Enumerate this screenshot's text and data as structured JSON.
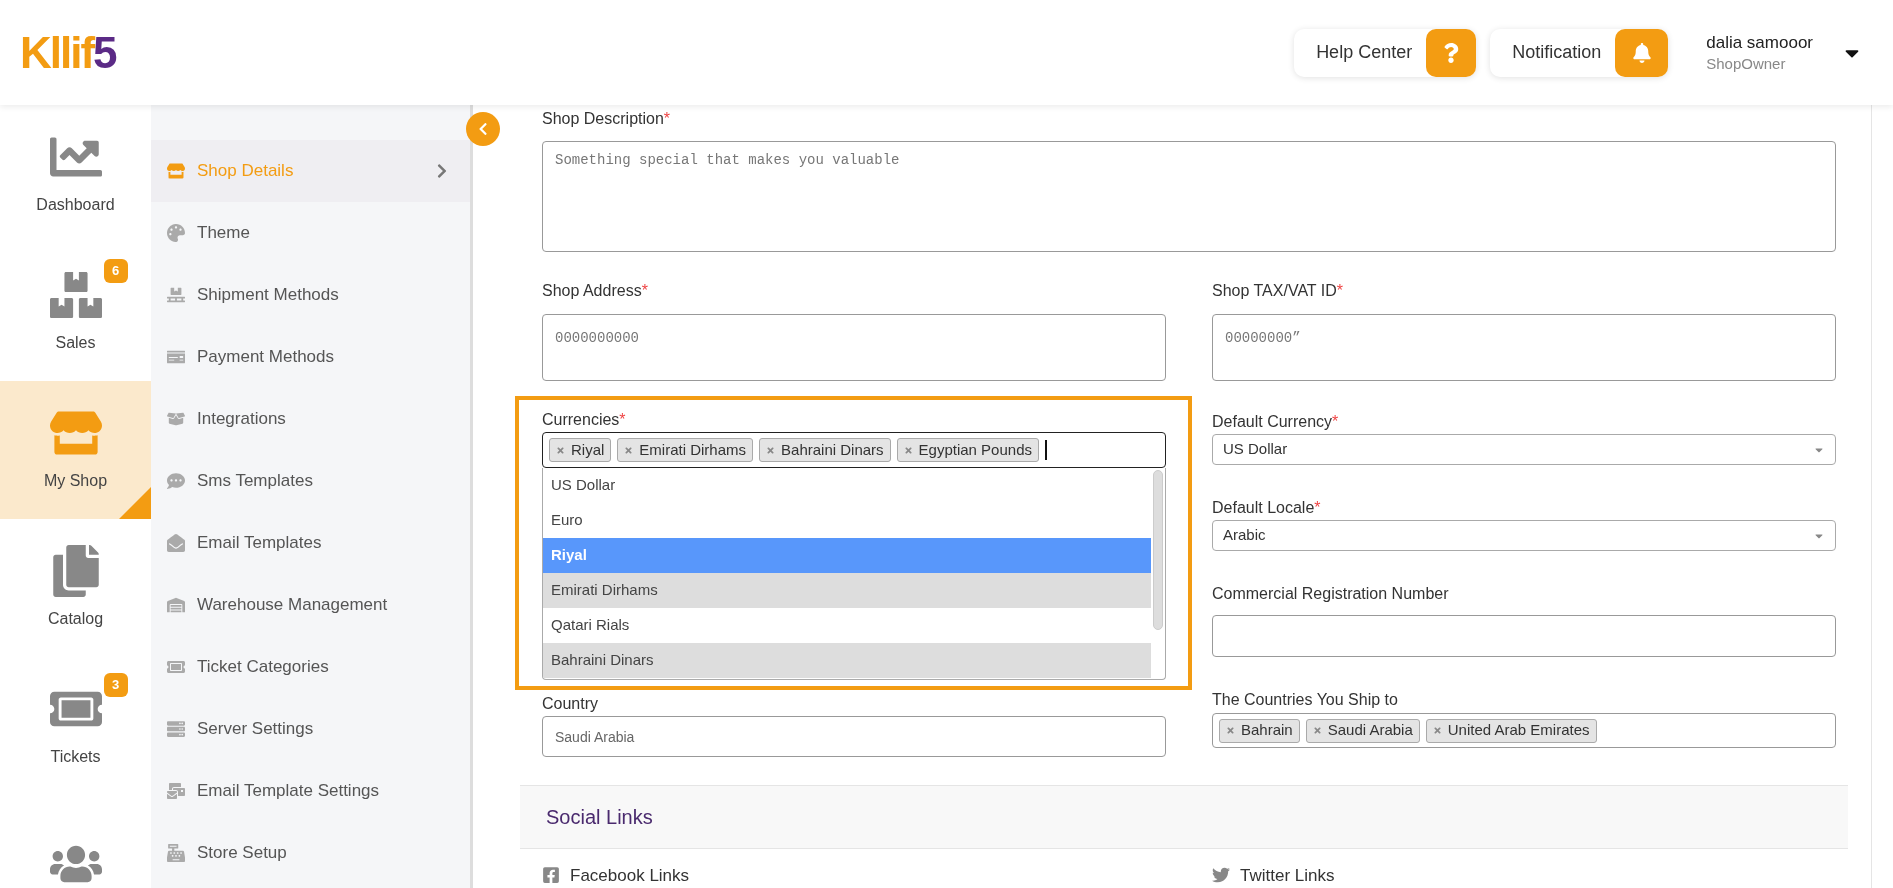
{
  "header": {
    "logo": {
      "main": "Kllif",
      "tail": "5"
    },
    "help": "Help Center",
    "notification": "Notification",
    "user": {
      "name": "dalia samooor",
      "role": "ShopOwner"
    }
  },
  "rail": [
    {
      "label": "Dashboard",
      "selected": false
    },
    {
      "label": "Sales",
      "badge": "6",
      "selected": false
    },
    {
      "label": "My Shop",
      "selected": true
    },
    {
      "label": "Catalog",
      "selected": false
    },
    {
      "label": "Tickets",
      "badge": "3",
      "selected": false
    },
    {
      "selected": false
    }
  ],
  "submenu": [
    {
      "label": "Shop Details",
      "selected": true
    },
    {
      "label": "Theme",
      "selected": false
    },
    {
      "label": "Shipment Methods",
      "selected": false
    },
    {
      "label": "Payment Methods",
      "selected": false
    },
    {
      "label": "Integrations",
      "selected": false
    },
    {
      "label": "Sms Templates",
      "selected": false
    },
    {
      "label": "Email Templates",
      "selected": false
    },
    {
      "label": "Warehouse Management",
      "selected": false
    },
    {
      "label": "Ticket Categories",
      "selected": false
    },
    {
      "label": "Server Settings",
      "selected": false
    },
    {
      "label": "Email Template Settings",
      "selected": false
    },
    {
      "label": "Store Setup",
      "selected": false
    }
  ],
  "form": {
    "description": {
      "label": "Shop Description",
      "mark": "*",
      "placeholder": "Something special that makes you valuable"
    },
    "address": {
      "label": "Shop Address",
      "mark": "*",
      "placeholder": "0000000000"
    },
    "tax": {
      "label": "Shop TAX/VAT ID",
      "mark": "*",
      "placeholder": "00000000”"
    },
    "currencies": {
      "label": "Currencies",
      "mark": "*",
      "tags": [
        "Riyal",
        "Emirati Dirhams",
        "Bahraini Dinars",
        "Egyptian Pounds"
      ],
      "options": [
        {
          "label": "US Dollar",
          "highlighted": false,
          "selected": false
        },
        {
          "label": "Euro",
          "highlighted": false,
          "selected": false
        },
        {
          "label": "Riyal",
          "highlighted": true,
          "selected": true
        },
        {
          "label": "Emirati Dirhams",
          "highlighted": false,
          "selected": true
        },
        {
          "label": "Qatari Rials",
          "highlighted": false,
          "selected": false
        },
        {
          "label": "Bahraini Dinars",
          "highlighted": false,
          "selected": true
        }
      ]
    },
    "default_currency": {
      "label": "Default Currency",
      "mark": "*",
      "value": "US Dollar"
    },
    "default_locale": {
      "label": "Default Locale",
      "mark": "*",
      "value": "Arabic"
    },
    "registration": {
      "label": "Commercial Registration Number"
    },
    "country": {
      "label": "Country",
      "value": "Saudi Arabia"
    },
    "ship_to": {
      "label": "The Countries You Ship to",
      "tags": [
        "Bahrain",
        "Saudi Arabia",
        "United Arab Emirates"
      ]
    }
  },
  "social": {
    "title": "Social Links",
    "links": [
      "Facebook Links",
      "Twitter Links"
    ]
  }
}
